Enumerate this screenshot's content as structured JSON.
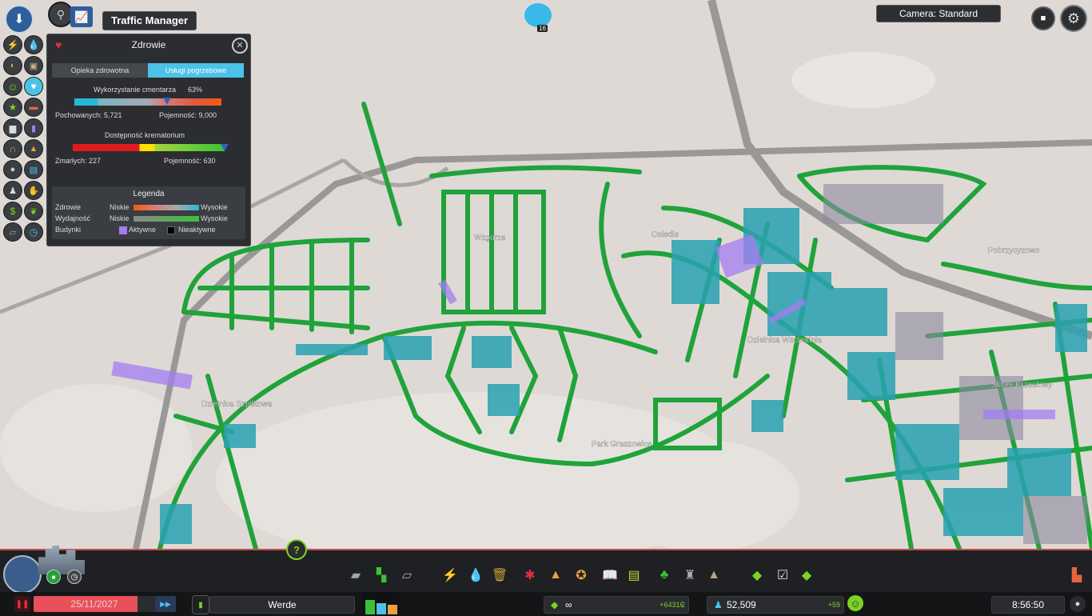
{
  "top": {
    "traffic_manager_label": "Traffic Manager",
    "camera_label": "Camera: Standard",
    "chirper_count": "16"
  },
  "panel": {
    "title": "Zdrowie",
    "tabs": [
      {
        "label": "Opieka zdrowotna",
        "active": false
      },
      {
        "label": "Usługi pogrzebowe",
        "active": true
      }
    ],
    "cemetery": {
      "label": "Wykorzystanie cmentarza",
      "percent_label": "63%",
      "percent": 63,
      "buried_label": "Pochowanych: 5,721",
      "capacity_label": "Pojemność: 9,000"
    },
    "crematorium": {
      "label": "Dostępność krematorium",
      "level": 1.0,
      "dead_label": "Zmarłych: 227",
      "capacity_label": "Pojemność: 630"
    },
    "legend": {
      "title": "Legenda",
      "rows": [
        {
          "name": "Zdrowie",
          "low": "Niskie",
          "high": "Wysokie"
        },
        {
          "name": "Wydajność",
          "low": "Niskie",
          "high": "Wysokie"
        }
      ],
      "buildings_label": "Budynki",
      "active_label": "Aktywne",
      "inactive_label": "Nieaktywne"
    }
  },
  "map_labels": [
    "Wzgórze",
    "Dzielnica Szpilkowa",
    "Park Graszowice",
    "Pobrzycyzowo",
    "Skwer Krzeslowy",
    "Osiedle",
    "Dzielnica Wschodnia"
  ],
  "bottom": {
    "date": "25/11/2027",
    "city_name": "Werde",
    "money_infinite": "∞",
    "income": "+6431₢",
    "population": "52,509",
    "population_change": "+59",
    "time": "8:56:50"
  },
  "colors": {
    "road_green": "#1fa33a",
    "building_teal": "#2aa1b3",
    "panel_bg": "#2b2d30",
    "tab_active": "#4bc2e8",
    "terrain": "#dcd8d3"
  }
}
